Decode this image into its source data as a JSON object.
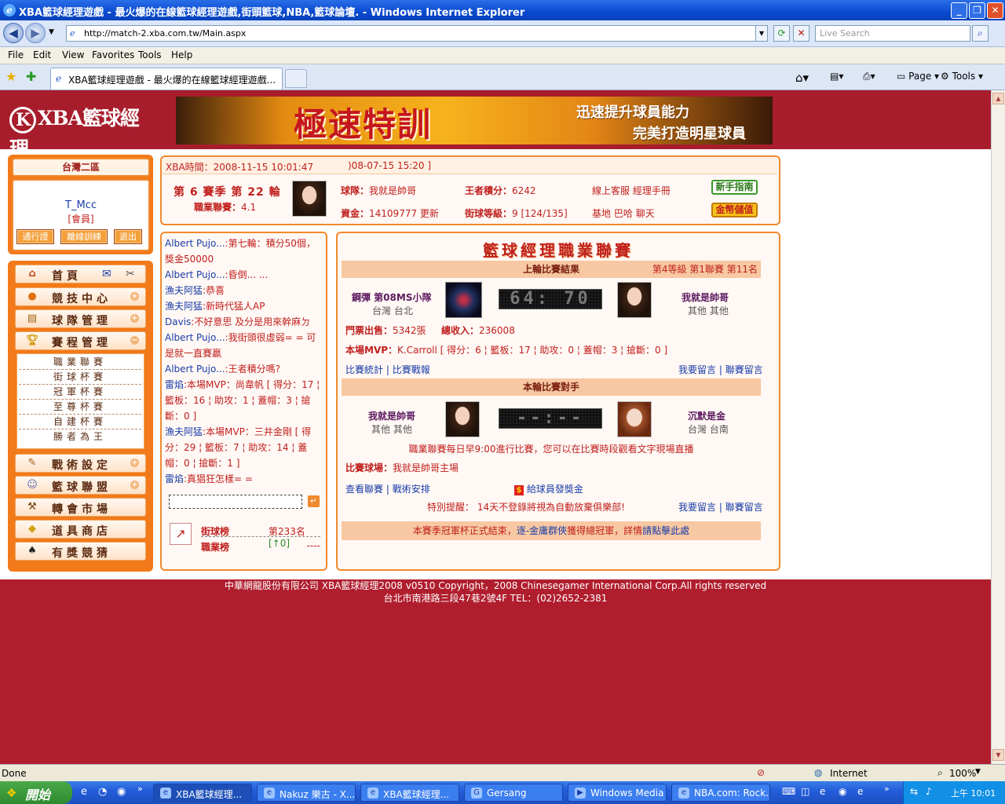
{
  "window": {
    "title": "XBA籃球經理遊戲 - 最火爆的在線籃球經理遊戲,街頭籃球,NBA,籃球論壇. - Windows Internet Explorer"
  },
  "address": {
    "url": "http://match-2.xba.com.tw/Main.aspx",
    "search_placeholder": "Live Search"
  },
  "menu": {
    "file": "File",
    "edit": "Edit",
    "view": "View",
    "favorites": "Favorites",
    "tools": "Tools",
    "help": "Help"
  },
  "tab": {
    "label": "XBA籃球經理遊戲 - 最火爆的在線籃球經理遊戲..."
  },
  "toolbar": {
    "page": "Page",
    "tools": "Tools"
  },
  "site": {
    "logo": "XBA籃球經理",
    "logo_mark": "K"
  },
  "banner": {
    "title": "極速特訓",
    "line1": "迅速提升球員能力",
    "line2": "完美打造明星球員"
  },
  "user": {
    "area": "台灣二區",
    "name": "T_Mcc",
    "role": "[會員]",
    "btn_pass": "通行證",
    "btn_offline": "離線訓練",
    "btn_exit": "退出"
  },
  "nav": {
    "home": "首頁",
    "compete": "競技中心",
    "team": "球隊管理",
    "schedule": "賽程管理",
    "tactics": "戰術設定",
    "alliance": "籃球聯盟",
    "transfer": "轉會市場",
    "shop": "道具商店",
    "guess": "有獎競猜"
  },
  "sub": [
    "職業聯賽",
    "街球杯賽",
    "冠軍杯賽",
    "至尊杯賽",
    "自建杯賽",
    "勝者為王"
  ],
  "info": {
    "time": "XBA時間：2008-11-15 10:01:47",
    "ticker": ")08-07-15 15:20 ]",
    "season": "第 6 賽季 第 22 輪",
    "league_label": "職業聯賽：",
    "league_val": "4.1",
    "team_label": "球隊：",
    "team_val": "我就是帥哥",
    "king_label": "王者積分：",
    "king_val": "6242",
    "cs": "線上客服",
    "manual": "經理手冊",
    "guide_btn": "新手指南",
    "money_label": "資金：",
    "money_val": "14109777",
    "refresh": "更新",
    "street_label": "街球等級：",
    "street_val": "9 [124/135]",
    "base": "基地",
    "bar": "巴哈",
    "chat": "聊天",
    "store_btn": "金幣儲值"
  },
  "chat": {
    "lines": [
      {
        "n": "Albert Pujo...",
        "t": ":第七輪：積分50個，獎金50000"
      },
      {
        "n": "Albert Pujo...",
        "t": ":昏倒... ..."
      },
      {
        "n": "漁夫阿猛",
        "t": ":恭喜"
      },
      {
        "n": "漁夫阿猛",
        "t": ":新時代猛人AP"
      },
      {
        "n": "Davis",
        "t": ":不好意思  及分是用來幹麻ㄉ"
      },
      {
        "n": "Albert Pujo...",
        "t": ":我街頭很虛弱= = 可是就一直賽贏"
      },
      {
        "n": "Albert Pujo...",
        "t": ":王者積分嗎?"
      },
      {
        "n": "雷焰",
        "t": ":本場MVP：尚韋帆 [ 得分：17 ¦ 籃板：16 ¦ 助攻：1 ¦ 蓋帽：3 ¦ 搶斷：0 ]"
      },
      {
        "n": "漁夫阿猛",
        "t": ":本場MVP：三井金剛 [ 得分：29 ¦ 籃板：7 ¦ 助攻：14 ¦ 蓋帽：0 ¦ 搶斷：1 ]"
      },
      {
        "n": "雷焰",
        "t": ":真猖狂怎樣= ="
      }
    ],
    "rank1_label": "街球榜",
    "rank1_val": "第233名",
    "rank1_delta": "[↑0]",
    "rank2_label": "職業榜",
    "rank2_val": "----"
  },
  "league": {
    "title": "籃球經理職業聯賽",
    "last_hdr": "上輪比賽結果",
    "last_meta": "第4等級  第1聯賽  第11名",
    "home_team": "鋼彈 第08MS小隊",
    "home_loc": "台灣 台北",
    "score": "64: 70",
    "away_team": "我就是帥哥",
    "away_loc": "其他 其他",
    "tickets_label": "門票出售：",
    "tickets_val": "5342張",
    "income_label": "總收入：",
    "income_val": "236008",
    "mvp_label": "本場MVP：",
    "mvp_val": "K.Carroll [ 得分：6 ¦ 籃板：17 ¦ 助攻：0 ¦ 蓋帽：3 ¦ 搶斷：0 ]",
    "stats_link": "比賽統計",
    "report_link": "比賽戰報",
    "msg_link": "我要留言",
    "league_msg_link": "聯賽留言",
    "next_hdr": "本輪比賽對手",
    "n_home": "我就是帥哥",
    "n_home_loc": "其他 其他",
    "n_score": "--:--",
    "n_away": "沉默是金",
    "n_away_loc": "台灣 台南",
    "notice": "職業聯賽每日早9:00進行比賽，您可以在比賽時段觀看文字現場直播",
    "arena_label": "比賽球場：",
    "arena_val": "我就是帥哥主場",
    "view_league": "查看聯賽",
    "tactics_link": "戰術安排",
    "bonus": "給球員發獎金",
    "remind": "特別提醒： 14天不登錄將視為自動放棄俱樂部!",
    "msg_link2": "我要留言",
    "league_msg_link2": "聯賽留言",
    "news_a": "本賽季冠軍杯正式結束，",
    "news_team": "逐-金庸群俠",
    "news_b": "獲得總冠軍，詳情",
    "news_link": "請點擊此處"
  },
  "footer": {
    "l1": "中華網龍股份有限公司  XBA籃球經理2008 v0510     Copyright，2008 Chinesegamer International Corp.All rights reserved",
    "l2": "台北市南港路三段47巷2號4F TEL：(02)2652-2381"
  },
  "status": {
    "done": "Done",
    "zone": "Internet",
    "zoom": "100%"
  },
  "taskbar": {
    "start": "開始",
    "tasks": [
      "XBA籃球經理...",
      "Nakuz 樂古 - X...",
      "XBA籃球經理...",
      "Gersang",
      "Windows Media ...",
      "NBA.com: Rock..."
    ],
    "clock": "上午 10:01"
  },
  "colors": {
    "brand_red": "#b01e2e",
    "accent_orange": "#f27a1a",
    "link_blue": "#1a3ca8"
  }
}
